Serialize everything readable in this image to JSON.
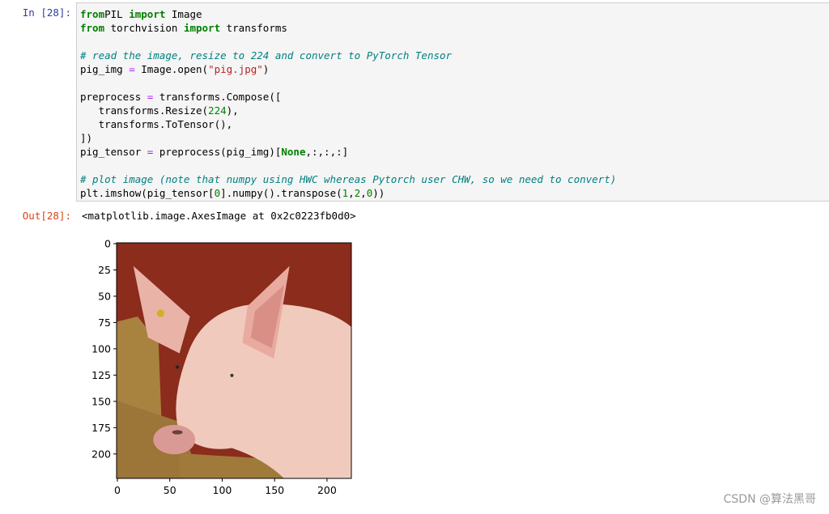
{
  "cell": {
    "in_prompt": "In  [28]:",
    "out_prompt": "Out[28]:",
    "code_lines": [
      [
        [
          "kw",
          "from"
        ],
        [
          "",
          "PIL "
        ],
        [
          "kw",
          "import"
        ],
        [
          "",
          " Image"
        ]
      ],
      [
        [
          "kw",
          "from"
        ],
        [
          "",
          " torchvision "
        ],
        [
          "kw",
          "import"
        ],
        [
          "",
          " transforms"
        ]
      ],
      [],
      [
        [
          "cm",
          "# read the image, resize to 224 and convert to PyTorch Tensor"
        ]
      ],
      [
        [
          "",
          "pig_img "
        ],
        [
          "op",
          "="
        ],
        [
          "",
          " Image.open("
        ],
        [
          "st",
          "\"pig.jpg\""
        ],
        [
          "",
          ")"
        ]
      ],
      [],
      [
        [
          "",
          "preprocess "
        ],
        [
          "op",
          "="
        ],
        [
          "",
          " transforms.Compose(["
        ]
      ],
      [
        [
          "",
          "   transforms.Resize("
        ],
        [
          "nu",
          "224"
        ],
        [
          "",
          "),"
        ]
      ],
      [
        [
          "",
          "   transforms.ToTensor(),"
        ]
      ],
      [
        [
          "",
          "])"
        ]
      ],
      [
        [
          "",
          "pig_tensor "
        ],
        [
          "op",
          "="
        ],
        [
          "",
          " preprocess(pig_img)["
        ],
        [
          "kw",
          "None"
        ],
        [
          "",
          ",:,:,:]"
        ]
      ],
      [],
      [
        [
          "cm",
          "# plot image (note that numpy using HWC whereas Pytorch user CHW, so we need to convert)"
        ]
      ],
      [
        [
          "",
          "plt.imshow(pig_tensor["
        ],
        [
          "nu",
          "0"
        ],
        [
          "",
          "].numpy().transpose("
        ],
        [
          "nu",
          "1"
        ],
        [
          "",
          ","
        ],
        [
          "nu",
          "2"
        ],
        [
          "",
          ","
        ],
        [
          "nu",
          "0"
        ],
        [
          "",
          "))"
        ]
      ]
    ],
    "output_text": "<matplotlib.image.AxesImage at 0x2c0223fb0d0>"
  },
  "plot": {
    "image_description_alt": "pig",
    "x_ticks": [
      "0",
      "50",
      "100",
      "150",
      "200"
    ],
    "y_ticks": [
      "0",
      "25",
      "50",
      "75",
      "100",
      "125",
      "150",
      "175",
      "200"
    ],
    "x_tick_values": [
      0,
      50,
      100,
      150,
      200
    ],
    "y_tick_values": [
      0,
      25,
      50,
      75,
      100,
      125,
      150,
      175,
      200
    ],
    "xlim": [
      0,
      224
    ],
    "ylim": [
      224,
      0
    ]
  },
  "watermark": "CSDN @算法黑哥"
}
